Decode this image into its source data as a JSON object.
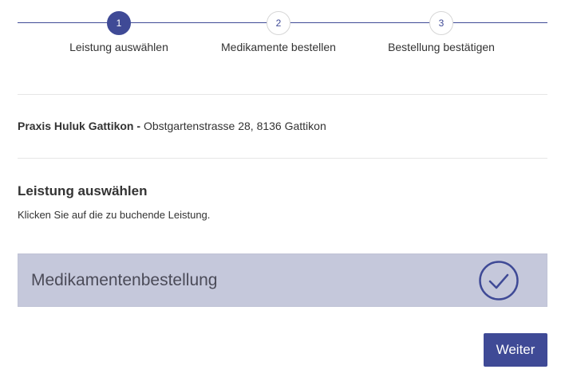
{
  "stepper": {
    "steps": [
      {
        "number": "1",
        "label": "Leistung auswählen",
        "active": true
      },
      {
        "number": "2",
        "label": "Medikamente bestellen",
        "active": false
      },
      {
        "number": "3",
        "label": "Bestellung bestätigen",
        "active": false
      }
    ],
    "accent_color": "#3f4a96"
  },
  "practice": {
    "name": "Praxis Huluk Gattikon -",
    "address": "Obstgartenstrasse 28, 8136 Gattikon"
  },
  "service_section": {
    "title": "Leistung auswählen",
    "hint": "Klicken Sie auf die zu buchende Leistung."
  },
  "services": [
    {
      "name": "Medikamentenbestellung",
      "selected": true,
      "icon": "check-circle-icon",
      "background": "#c5c8db"
    }
  ],
  "actions": {
    "next_label": "Weiter"
  }
}
